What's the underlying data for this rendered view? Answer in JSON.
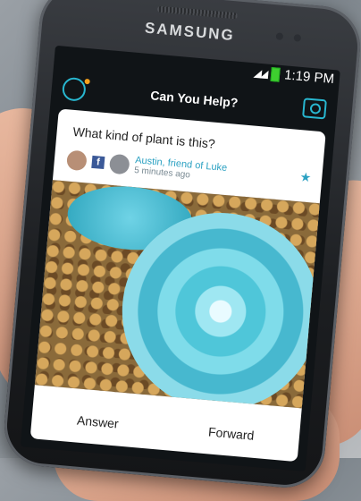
{
  "device": {
    "brand": "SAMSUNG"
  },
  "status_bar": {
    "time": "1:19 PM"
  },
  "app_header": {
    "title": "Can You Help?"
  },
  "post": {
    "question": "What kind of plant is this?",
    "author": "Austin, friend of Luke",
    "time": "5 minutes ago"
  },
  "actions": {
    "answer": "Answer",
    "forward": "Forward"
  },
  "icons": {
    "profile": "profile-icon",
    "camera": "camera-icon",
    "facebook": "facebook-icon",
    "star": "star-icon"
  }
}
